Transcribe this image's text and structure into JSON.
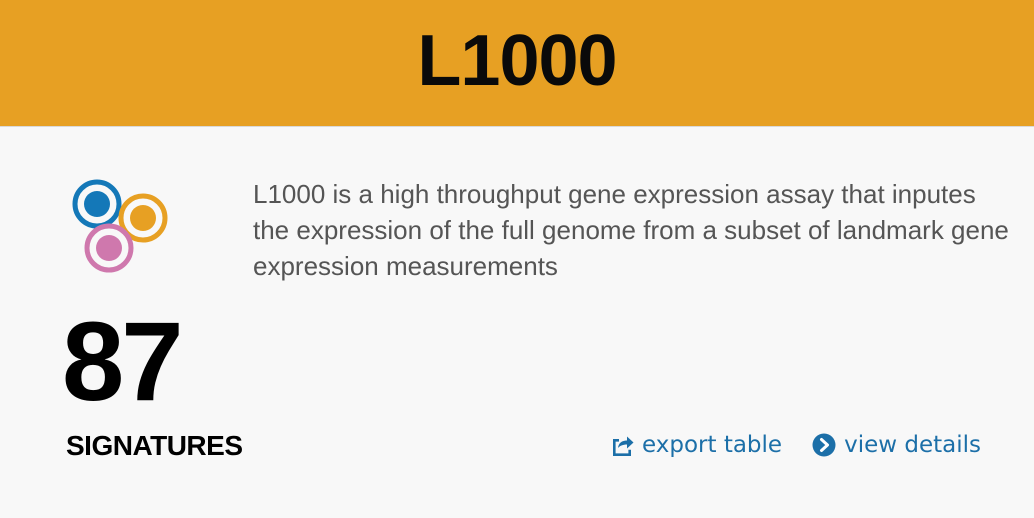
{
  "header": {
    "title": "L1000",
    "background_color": "#e7a023"
  },
  "logo": {
    "icon": "l1000-circles-logo-icon",
    "colors": [
      "#1478b8",
      "#e7a023",
      "#cf78ad"
    ]
  },
  "description": "L1000 is a high throughput gene expression assay that inputes the expression of the full genome from a subset of landmark gene expression measurements",
  "stats": {
    "count": "87",
    "label": "SIGNATURES"
  },
  "actions": {
    "export": {
      "label": "export table",
      "icon": "share-export-icon"
    },
    "details": {
      "label": "view details",
      "icon": "chevron-circle-right-icon"
    }
  },
  "colors": {
    "link": "#1c6fa8",
    "text": "#555555"
  }
}
